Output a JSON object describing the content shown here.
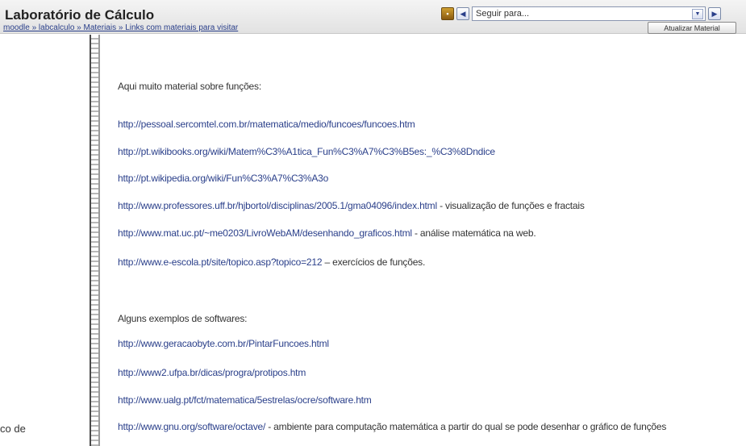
{
  "header": {
    "site_title": "Laboratório de Cálculo",
    "jump_placeholder": "Seguir para...",
    "breadcrumb": "moodle » labcalculo » Materiais » Links com materiais para visitar",
    "update_button": "Atualizar Material"
  },
  "left_column": {
    "cut_text": "co de"
  },
  "main": {
    "intro1": "Aqui muito material sobre funções:",
    "intro2": "Alguns exemplos de softwares:",
    "links": [
      {
        "url": "http://pessoal.sercomtel.com.br/matematica/medio/funcoes/funcoes.htm",
        "desc": ""
      },
      {
        "url": "http://pt.wikibooks.org/wiki/Matem%C3%A1tica_Fun%C3%A7%C3%B5es:_%C3%8Dndice",
        "desc": ""
      },
      {
        "url": "http://pt.wikipedia.org/wiki/Fun%C3%A7%C3%A3o",
        "desc": ""
      },
      {
        "url": "http://www.professores.uff.br/hjbortol/disciplinas/2005.1/gma04096/index.html",
        "desc": " - visualização de funções e fractais"
      },
      {
        "url": "http://www.mat.uc.pt/~me0203/LivroWebAM/desenhando_graficos.html",
        "desc": " - análise matemática na web."
      },
      {
        "url": "http://www.e-escola.pt/site/topico.asp?topico=212",
        "desc": " – exercícios de funções."
      }
    ],
    "software_links": [
      {
        "url": "http://www.geracaobyte.com.br/PintarFuncoes.html",
        "desc": ""
      },
      {
        "url": "http://www2.ufpa.br/dicas/progra/protipos.htm",
        "desc": ""
      },
      {
        "url": "http://www.ualg.pt/fct/matematica/5estrelas/ocre/software.htm",
        "desc": ""
      },
      {
        "url": "http://www.gnu.org/software/octave/",
        "desc": " - ambiente para computação matemática a partir do qual se pode desenhar o gráfico de funções"
      }
    ]
  }
}
